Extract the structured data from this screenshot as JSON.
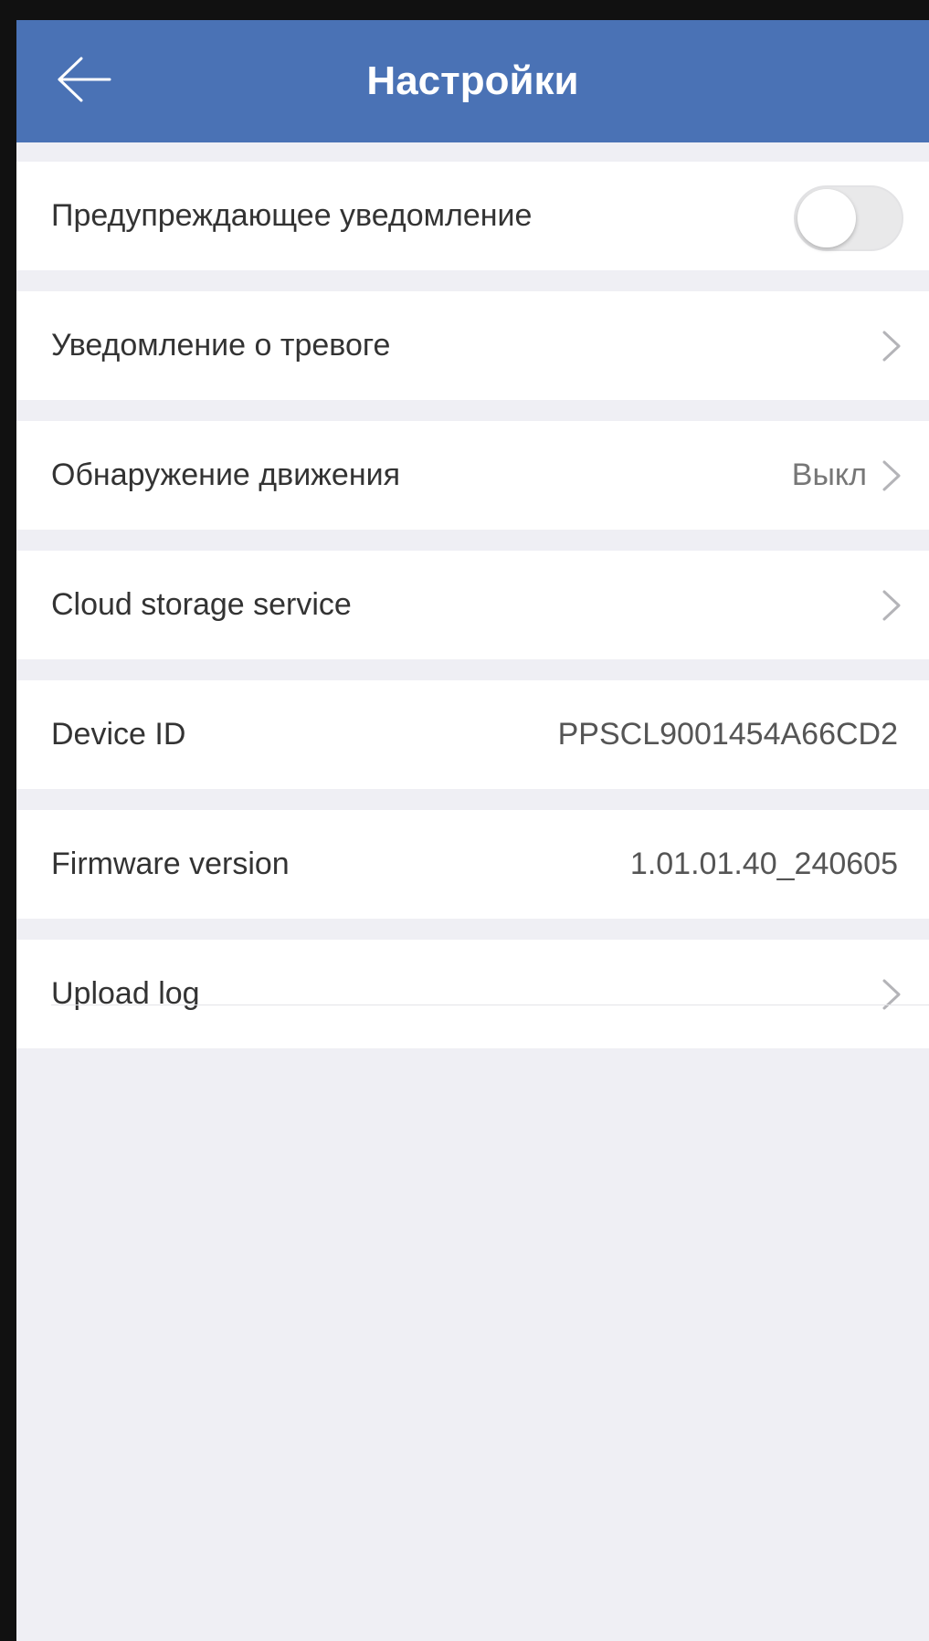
{
  "header": {
    "title": "Настройки",
    "back_icon": "arrow-left-icon",
    "background_color": "#4a72b5"
  },
  "settings": [
    {
      "label": "Предупреждающее уведомление",
      "type": "toggle",
      "toggle_on": false
    },
    {
      "label": "Уведомление о тревоге",
      "type": "link",
      "value": ""
    },
    {
      "label": "Обнаружение движения",
      "type": "link",
      "value": "Выкл"
    },
    {
      "label": "Cloud storage service",
      "type": "link",
      "value": ""
    },
    {
      "label": "Device ID",
      "type": "info",
      "value": "PPSCL9001454A66CD2"
    },
    {
      "label": "Firmware version",
      "type": "info",
      "value": "1.01.01.40_240605"
    },
    {
      "label": "Upload log",
      "type": "link",
      "value": ""
    }
  ],
  "colors": {
    "page_background": "#efeff4",
    "row_background": "#ffffff",
    "toggle_off": "#e9e9ea"
  }
}
